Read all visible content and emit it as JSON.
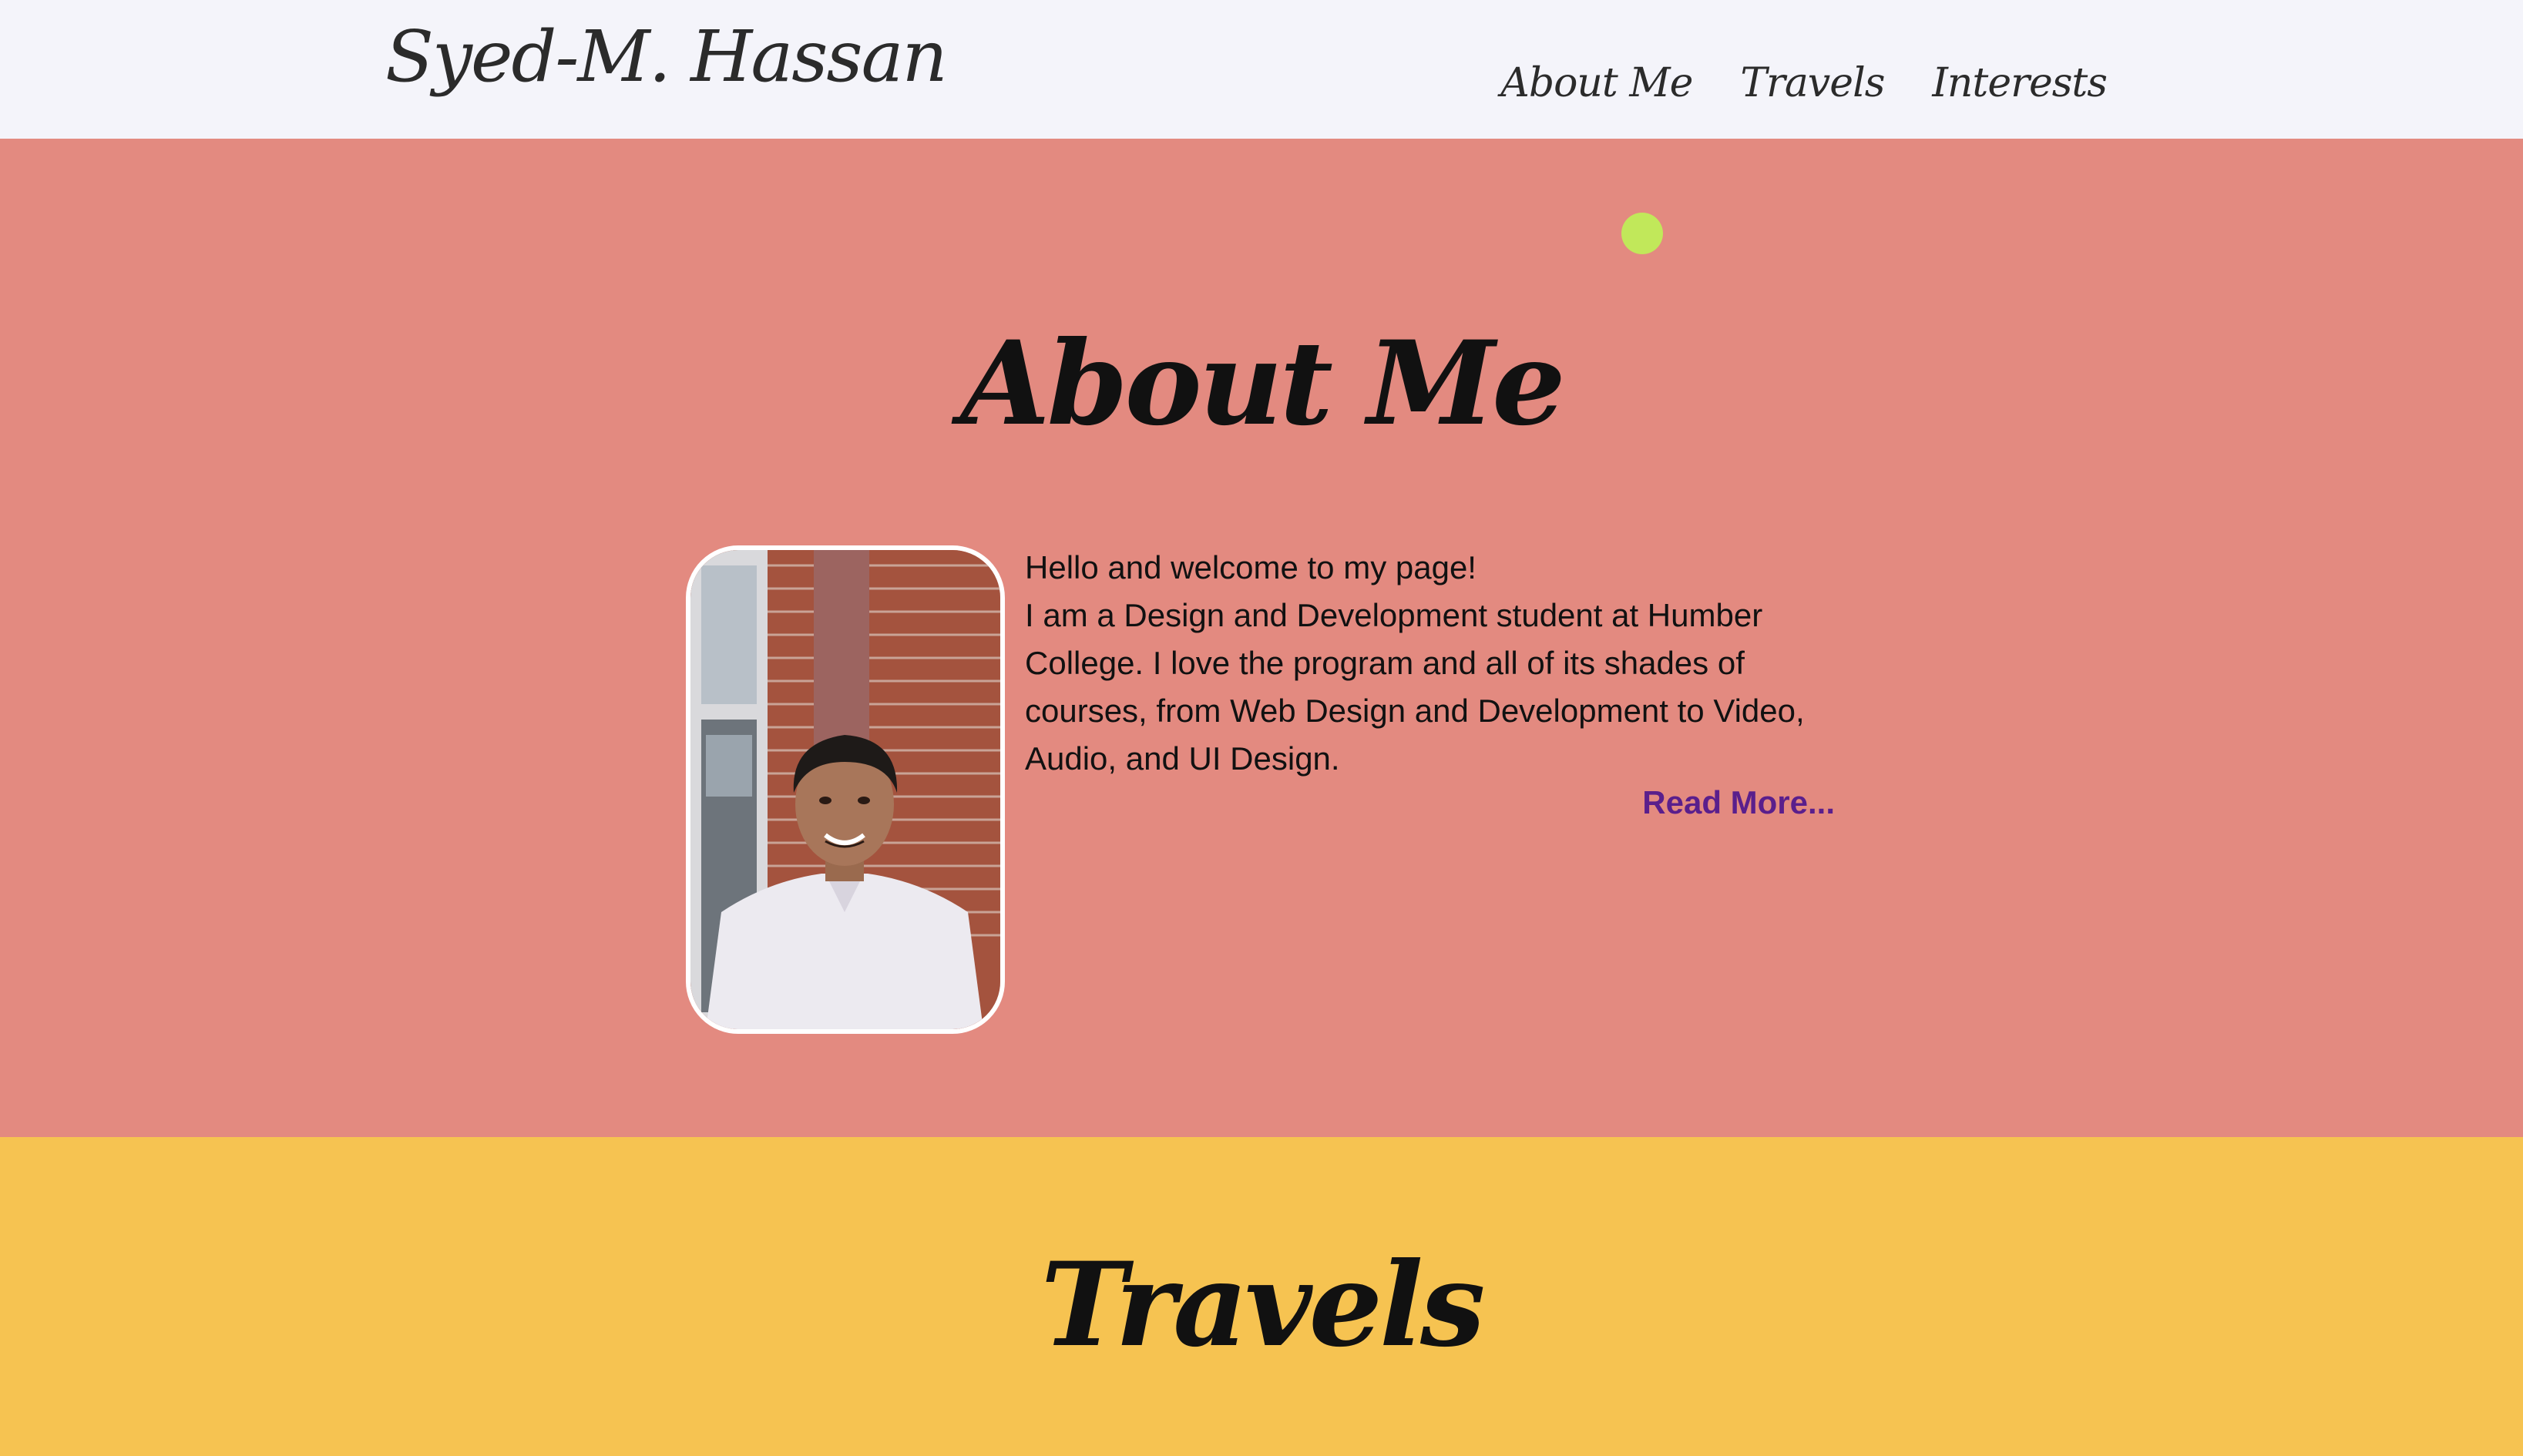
{
  "header": {
    "brand": "Syed-M. Hassan",
    "nav": [
      "About Me",
      "Travels",
      "Interests"
    ]
  },
  "about": {
    "title": "About Me",
    "greeting": "Hello and welcome to my page!",
    "body": "I am a Design and Development student at Humber College. I love the program and all of its shades of courses, from Web Design and Development to Video, Audio, and UI Design.",
    "read_more": "Read More..."
  },
  "travels": {
    "title": "Travels"
  },
  "colors": {
    "header_bg": "#f4f4fa",
    "about_bg": "#e38a80",
    "travels_bg": "#f6c351",
    "accent_dot": "#c1e85a",
    "link": "#5a1f8c"
  },
  "icons": {
    "decorative_dot": "green-circle"
  }
}
